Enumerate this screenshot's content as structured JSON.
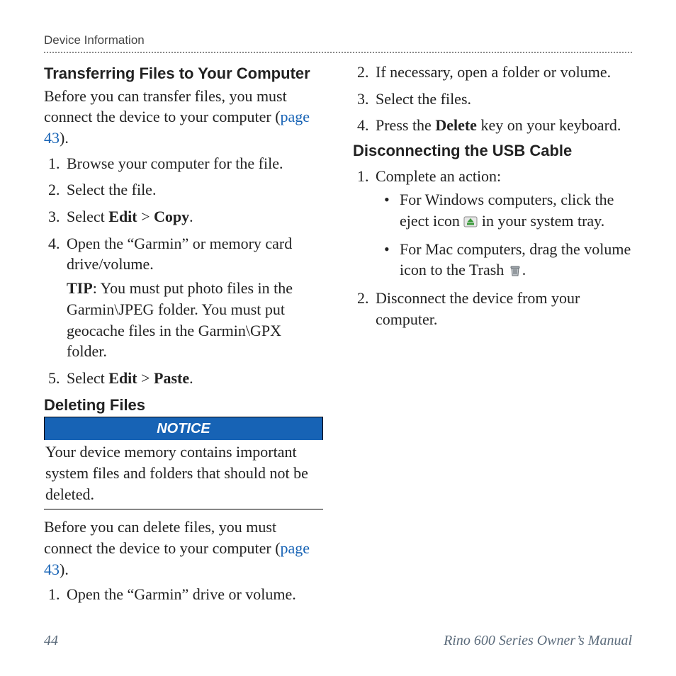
{
  "runningHead": "Device Information",
  "left": {
    "h1": "Transferring Files to Your Computer",
    "intro_a": "Before you can transfer files, you must connect the device to your computer (",
    "intro_link": "page 43",
    "intro_b": ").",
    "step1": "Browse your computer for the file.",
    "step2": "Select the file.",
    "step3_a": "Select ",
    "step3_b": "Edit",
    "step3_c": " > ",
    "step3_d": "Copy",
    "step3_e": ".",
    "step4": "Open the “Garmin” or memory card drive/volume.",
    "tip_label": "TIP",
    "tip_text": ": You must put photo files in the Garmin\\JPEG folder. You must put geocache files in the Garmin\\GPX folder.",
    "step5_a": "Select ",
    "step5_b": "Edit",
    "step5_c": " > ",
    "step5_d": "Paste",
    "step5_e": ".",
    "h2": "Deleting Files",
    "notice": "NOTICE",
    "notice_body": "Your device memory contains important system files and folders that should not be deleted."
  },
  "right": {
    "intro_a": "Before you can delete files, you must connect the device to your computer (",
    "intro_link": "page 43",
    "intro_b": ").",
    "step1": "Open the “Garmin” drive or volume.",
    "step2": "If necessary, open a folder or volume.",
    "step3": "Select the files.",
    "step4_a": "Press the ",
    "step4_b": "Delete",
    "step4_c": " key on your keyboard.",
    "h3": "Disconnecting the USB Cable",
    "d_step1": "Complete an action:",
    "bullet1_a": "For Windows computers, click the eject icon ",
    "bullet1_b": " in your system tray.",
    "bullet2_a": "For Mac computers, drag the volume icon to the Trash ",
    "bullet2_b": ".",
    "d_step2": "Disconnect the device from your computer."
  },
  "footer": {
    "page": "44",
    "title": "Rino 600 Series Owner’s Manual"
  }
}
